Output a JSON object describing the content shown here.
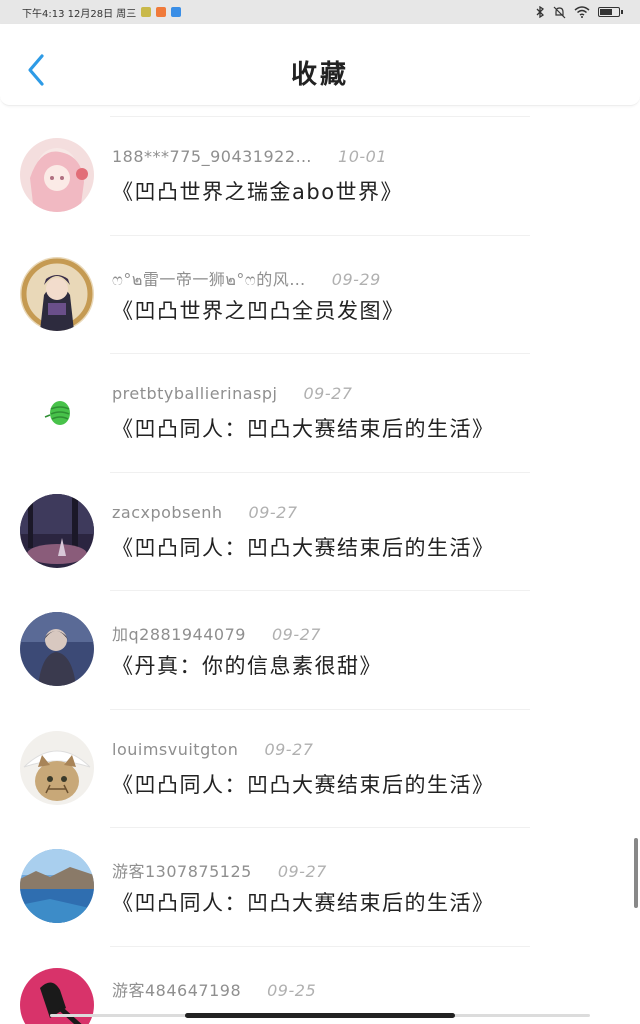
{
  "status_bar": {
    "time_text": "下午4:13 12月28日 周三",
    "app_icons": [
      "#c9b94a",
      "#f07a3a",
      "#3a8ee6"
    ]
  },
  "nav": {
    "title": "收藏",
    "back_icon": "chevron-left-icon",
    "accent": "#2e9be6"
  },
  "items": [
    {
      "user": "188***775_90431922…",
      "date": "10-01",
      "title": "《凹凸世界之瑞金abo世界》"
    },
    {
      "user": "ෆ°๒雷一帝一狮๒°ෆ的风…",
      "date": "09-29",
      "title": "《凹凸世界之凹凸全员发图》"
    },
    {
      "user": "pretbtyballierinaspj",
      "date": "09-27",
      "title": "《凹凸同人：凹凸大赛结束后的生活》"
    },
    {
      "user": "zacxpobsenh",
      "date": "09-27",
      "title": "《凹凸同人：凹凸大赛结束后的生活》"
    },
    {
      "user": "加q2881944079",
      "date": "09-27",
      "title": "《丹真：你的信息素很甜》"
    },
    {
      "user": "louimsvuitgton",
      "date": "09-27",
      "title": "《凹凸同人：凹凸大赛结束后的生活》"
    },
    {
      "user": "游客1307875125",
      "date": "09-27",
      "title": "《凹凸同人：凹凸大赛结束后的生活》"
    },
    {
      "user": "游客484647198",
      "date": "09-25",
      "title": ""
    }
  ]
}
